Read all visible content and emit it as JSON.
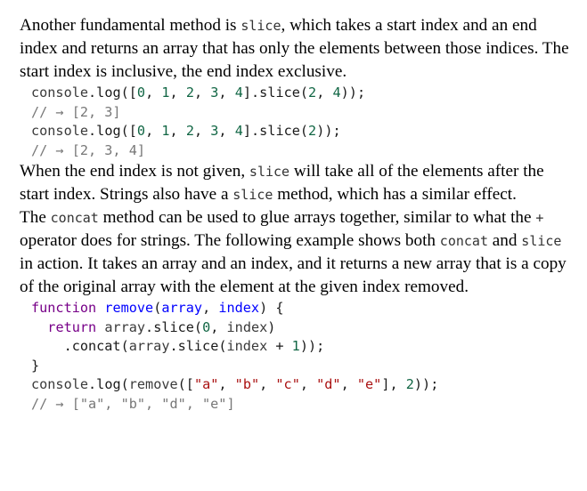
{
  "paragraph_1": {
    "text_a": "Another fundamental method is ",
    "code_a": "slice",
    "text_b": ", which takes a start index and an end index and returns an array that has only the elements between those indices. The start index is inclusive, the end index exclusive."
  },
  "code_block_1": {
    "lines": [
      "console.log([0, 1, 2, 3, 4].slice(2, 4));",
      "// → [2, 3]",
      "console.log([0, 1, 2, 3, 4].slice(2));",
      "// → [2, 3, 4]"
    ]
  },
  "paragraph_2": {
    "text_a": "When the end index is not given, ",
    "code_a": "slice",
    "text_b": " will take all of the elements after the start index. Strings also have a ",
    "code_b": "slice",
    "text_c": " method, which has a similar effect."
  },
  "paragraph_3": {
    "text_a": "The ",
    "code_a": "concat",
    "text_b": " method can be used to glue arrays together, similar to what the ",
    "code_b": "+",
    "text_c": " operator does for strings. The following example shows both ",
    "code_c": "concat",
    "text_d": " and ",
    "code_d": "slice",
    "text_e": " in action. It takes an array and an index, and it returns a new array that is a copy of the original array with the element at the given index removed."
  },
  "code_block_2": {
    "lines": [
      "function remove(array, index) {",
      "  return array.slice(0, index)",
      "    .concat(array.slice(index + 1));",
      "}",
      "console.log(remove([\"a\", \"b\", \"c\", \"d\", \"e\"], 2));",
      "// → [\"a\", \"b\", \"d\", \"e\"]"
    ]
  }
}
